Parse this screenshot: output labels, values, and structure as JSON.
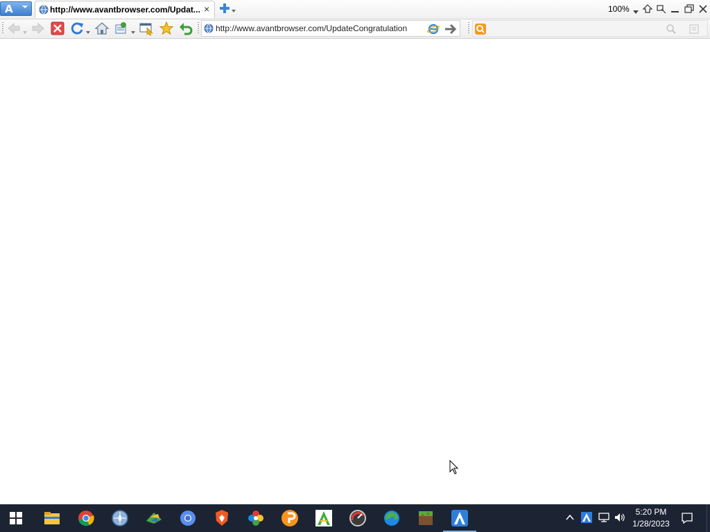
{
  "browser": {
    "app_menu_letter": "A",
    "active_tab": {
      "title": "http://www.avantbrowser.com/Updat...",
      "close_glyph": "×"
    },
    "zoom": "100%"
  },
  "toolbar": {
    "address_value": "http://www.avantbrowser.com/UpdateCongratulation",
    "search_value": ""
  },
  "taskbar": {
    "apps": [
      "file-explorer",
      "chrome",
      "avant-browser-icon-blue",
      "torch-browser",
      "chromium",
      "brave",
      "colorful-browser",
      "pale-moon-orange",
      "green-a-browser",
      "red-gauge-browser",
      "edge",
      "minecraft",
      "avant-browser"
    ],
    "clock_time": "5:20 PM",
    "clock_date": "1/28/2023"
  },
  "colors": {
    "taskbar_bg": "#1c2433",
    "accent": "#3d7fd0"
  }
}
